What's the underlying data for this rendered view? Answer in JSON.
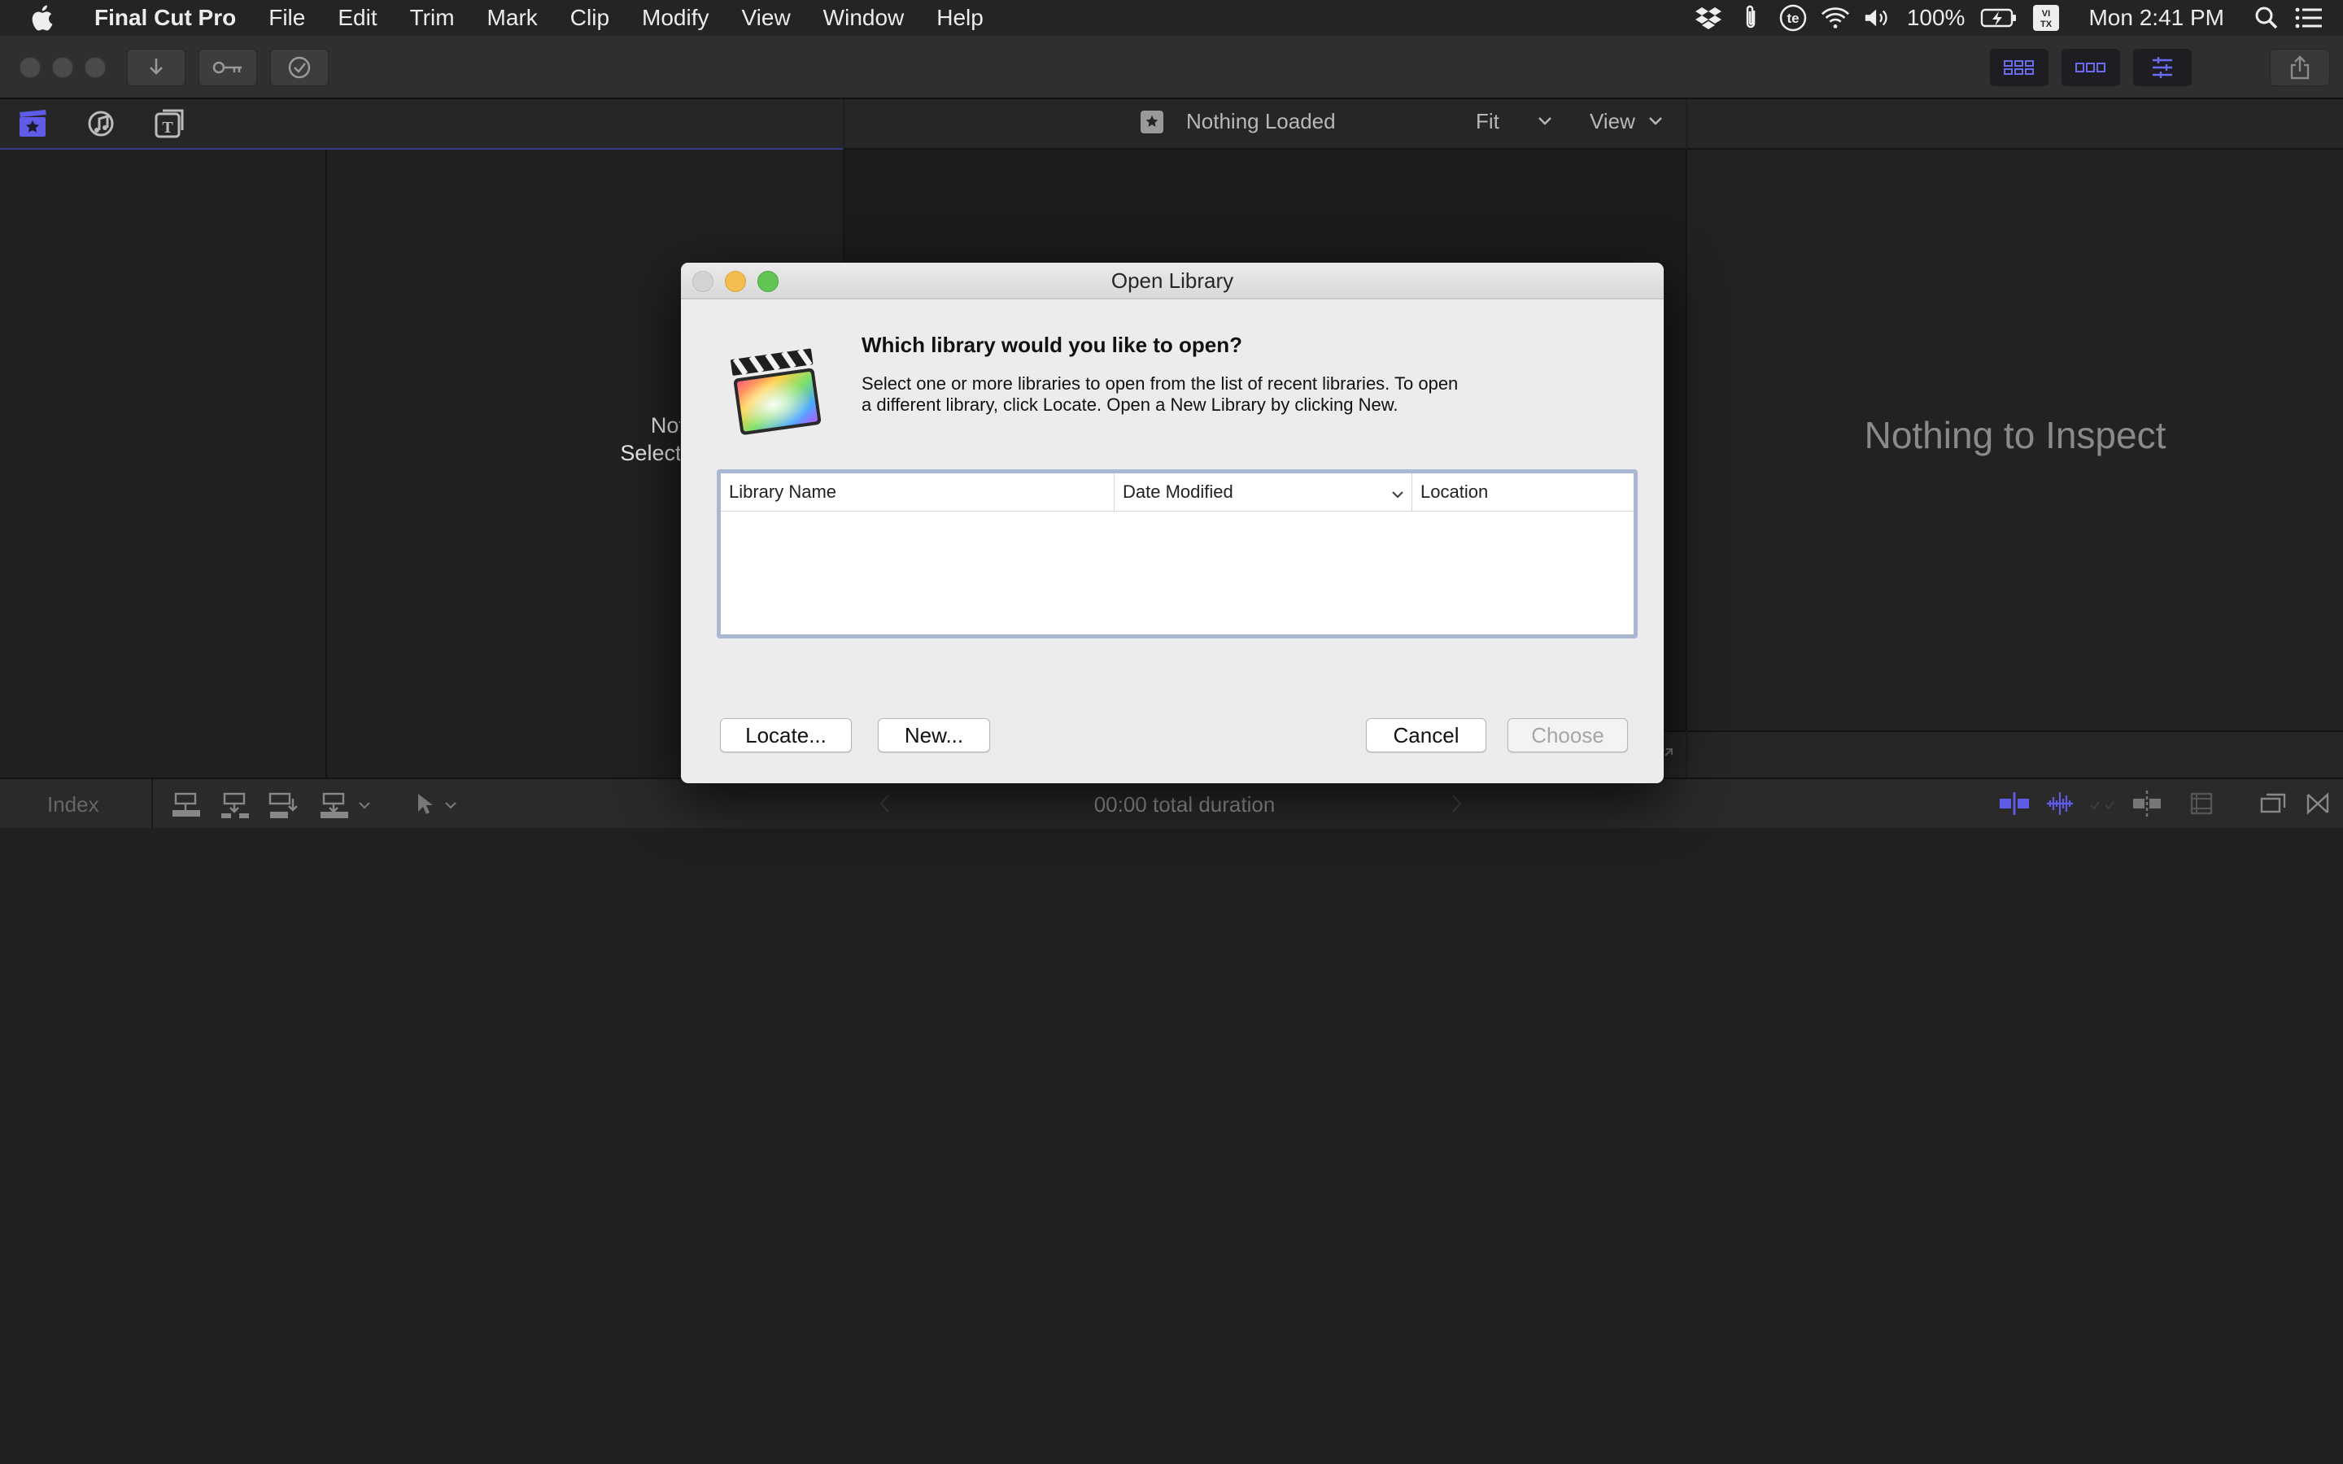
{
  "menubar": {
    "app_name": "Final Cut Pro",
    "items": [
      "File",
      "Edit",
      "Trim",
      "Mark",
      "Clip",
      "Modify",
      "View",
      "Window",
      "Help"
    ],
    "status": {
      "battery": "100%",
      "clock": "Mon 2:41 PM",
      "input_source": "VI\nTX"
    }
  },
  "viewer": {
    "title": "Nothing Loaded",
    "zoom": "Fit",
    "view_menu": "View"
  },
  "browser": {
    "empty_title": "Nothing Is Selected",
    "empty_hint": "Select an item from the Si"
  },
  "inspector": {
    "empty_text": "Nothing to Inspect"
  },
  "timeline": {
    "index_label": "Index",
    "duration": "00:00 total duration"
  },
  "dialog": {
    "title": "Open Library",
    "question": "Which library would you like to open?",
    "description_line1": "Select one or more libraries to open from the list of recent libraries.  To open",
    "description_line2": "a different library, click Locate. Open a New Library by clicking New.",
    "columns": [
      "Library Name",
      "Date Modified",
      "Location"
    ],
    "rows": [],
    "buttons": {
      "locate": "Locate...",
      "new": "New...",
      "cancel": "Cancel",
      "choose": "Choose"
    }
  },
  "colors": {
    "accent_blue": "#5e5ce6",
    "dialog_bg": "#ececec",
    "app_bg": "#1f1f1f"
  }
}
